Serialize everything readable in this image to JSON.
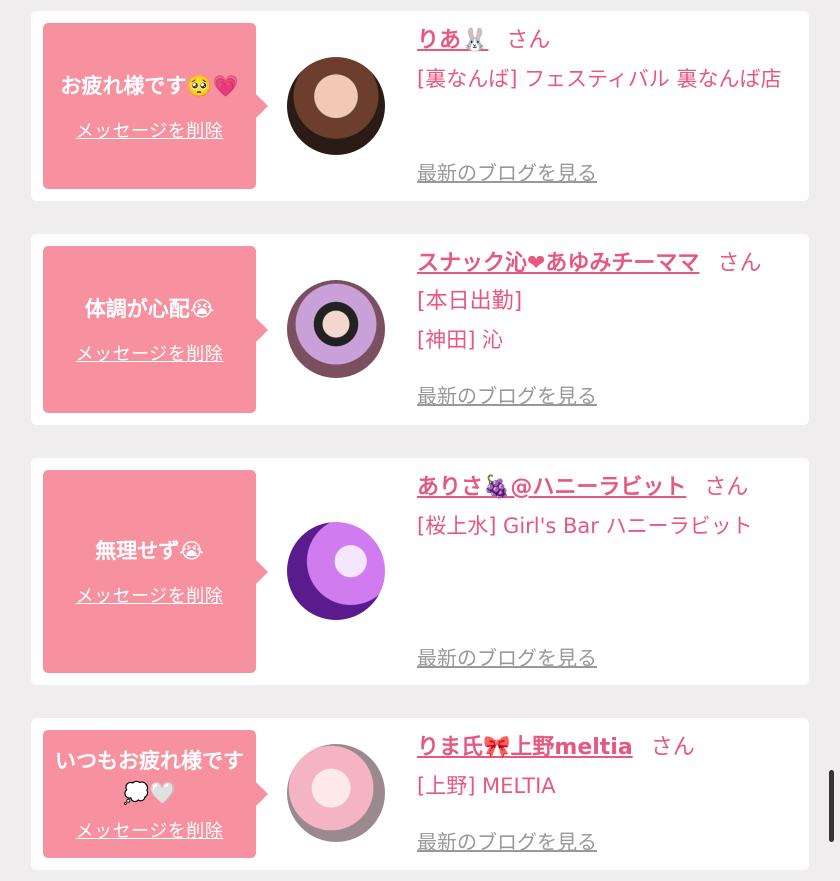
{
  "cards": [
    {
      "message": "お疲れ様です🥺💗",
      "delete_label": "メッセージを削除",
      "name": "りあ🐰",
      "honorific": "さん",
      "shop": "[裏なんば] フェスティバル 裏なんば店",
      "blog_label": "最新のブログを見る"
    },
    {
      "message": "体調が心配😭",
      "delete_label": "メッセージを削除",
      "name": "スナック沁❤あゆみチーママ",
      "honorific": "さん[本日出勤]",
      "shop": "[神田] 沁",
      "blog_label": "最新のブログを見る"
    },
    {
      "message": "無理せず😭",
      "delete_label": "メッセージを削除",
      "name": "ありさ🍇@ハニーラビット",
      "honorific": "さん",
      "shop": "[桜上水] Girl's Bar ハニーラビット",
      "blog_label": "最新のブログを見る"
    },
    {
      "message": "いつもお疲れ様です💭🤍",
      "delete_label": "メッセージを削除",
      "name": "りま氏🎀上野meltia",
      "honorific": "さん",
      "shop": "[上野] MELTIA",
      "blog_label": "最新のブログを見る"
    }
  ],
  "colors": {
    "accent": "#e75880",
    "bubble": "#f7919f",
    "background": "#efeded"
  }
}
